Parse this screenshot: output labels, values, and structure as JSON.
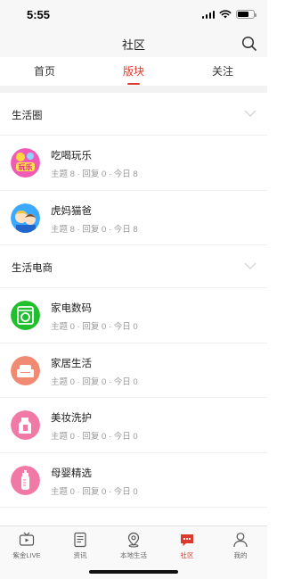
{
  "status_bar": {
    "time": "5:55"
  },
  "nav": {
    "title": "社区",
    "search_icon": "search-icon"
  },
  "top_tabs": [
    {
      "label": "首页",
      "active": false
    },
    {
      "label": "版块",
      "active": true
    },
    {
      "label": "关注",
      "active": false
    }
  ],
  "sections": [
    {
      "title": "生活圈",
      "items": [
        {
          "name": "吃喝玩乐",
          "stats": "主题 8 · 回复 0 · 今日 8",
          "icon": "food-fun-icon"
        },
        {
          "name": "虎妈猫爸",
          "stats": "主题 8 · 回复 0 · 今日 8",
          "icon": "parents-icon"
        }
      ]
    },
    {
      "title": "生活电商",
      "items": [
        {
          "name": "家电数码",
          "stats": "主题 0 · 回复 0 · 今日 0",
          "icon": "washing-machine-icon"
        },
        {
          "name": "家居生活",
          "stats": "主题 0 · 回复 0 · 今日 0",
          "icon": "sofa-icon"
        },
        {
          "name": "美妆洗护",
          "stats": "主题 0 · 回复 0 · 今日 0",
          "icon": "cosmetics-icon"
        },
        {
          "name": "母婴精选",
          "stats": "主题 0 · 回复 0 · 今日 0",
          "icon": "baby-bottle-icon"
        }
      ]
    }
  ],
  "tab_bar": [
    {
      "label": "紫金LIVE",
      "icon": "tv-icon",
      "active": false
    },
    {
      "label": "资讯",
      "icon": "news-icon",
      "active": false
    },
    {
      "label": "本地生活",
      "icon": "location-icon",
      "active": false
    },
    {
      "label": "社区",
      "icon": "chat-icon",
      "active": true
    },
    {
      "label": "我的",
      "icon": "person-icon",
      "active": false
    }
  ],
  "colors": {
    "accent": "#d93a2b",
    "green": "#1fbf2e",
    "salmon": "#f08a73",
    "pink": "#f07aa5"
  }
}
